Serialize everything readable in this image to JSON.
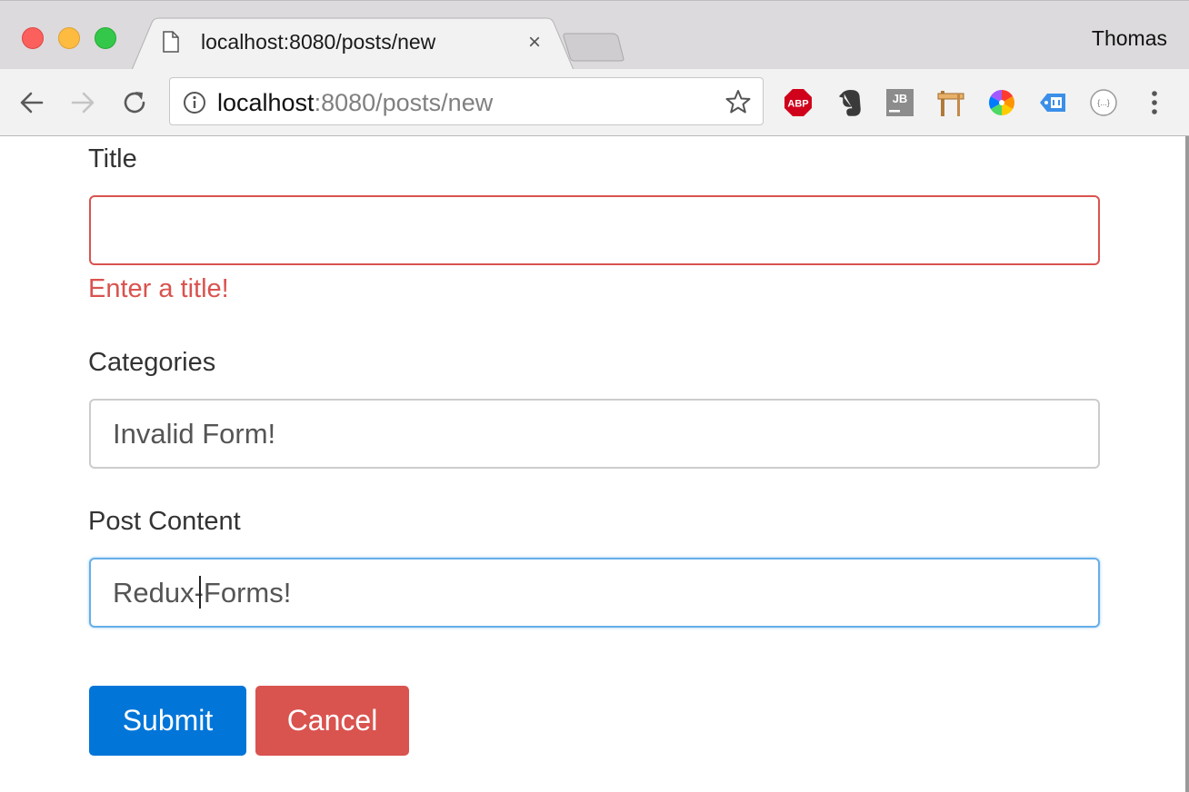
{
  "window": {
    "profile_name": "Thomas",
    "traffic_lights": {
      "close": "#fc605c",
      "minimize": "#fdbc40",
      "maximize": "#34c84a"
    }
  },
  "tab": {
    "title": "localhost:8080/posts/new",
    "close_glyph": "×",
    "icon": "file-icon"
  },
  "toolbar": {
    "back_icon": "back-arrow-icon",
    "forward_icon": "forward-arrow-icon",
    "reload_icon": "reload-icon",
    "url_host": "localhost",
    "url_rest": ":8080/posts/new",
    "bookmark_icon": "star-icon",
    "extensions": [
      {
        "name": "adblock-plus-icon",
        "label": "ABP"
      },
      {
        "name": "evernote-icon"
      },
      {
        "name": "jetbrains-icon",
        "label": "JB"
      },
      {
        "name": "construction-sign-icon"
      },
      {
        "name": "color-wheel-icon"
      },
      {
        "name": "tag-icon"
      },
      {
        "name": "json-formatter-icon",
        "label": "{...}"
      }
    ],
    "menu_icon": "kebab-menu-icon"
  },
  "form": {
    "title_label": "Title",
    "title_value": "",
    "title_error": "Enter a title!",
    "categories_label": "Categories",
    "categories_value": "Invalid Form!",
    "content_label": "Post Content",
    "content_value": "Redux-Forms!",
    "submit_label": "Submit",
    "cancel_label": "Cancel"
  },
  "colors": {
    "error": "#d9534f",
    "primary": "#0275d8",
    "focus": "#66afe9"
  }
}
